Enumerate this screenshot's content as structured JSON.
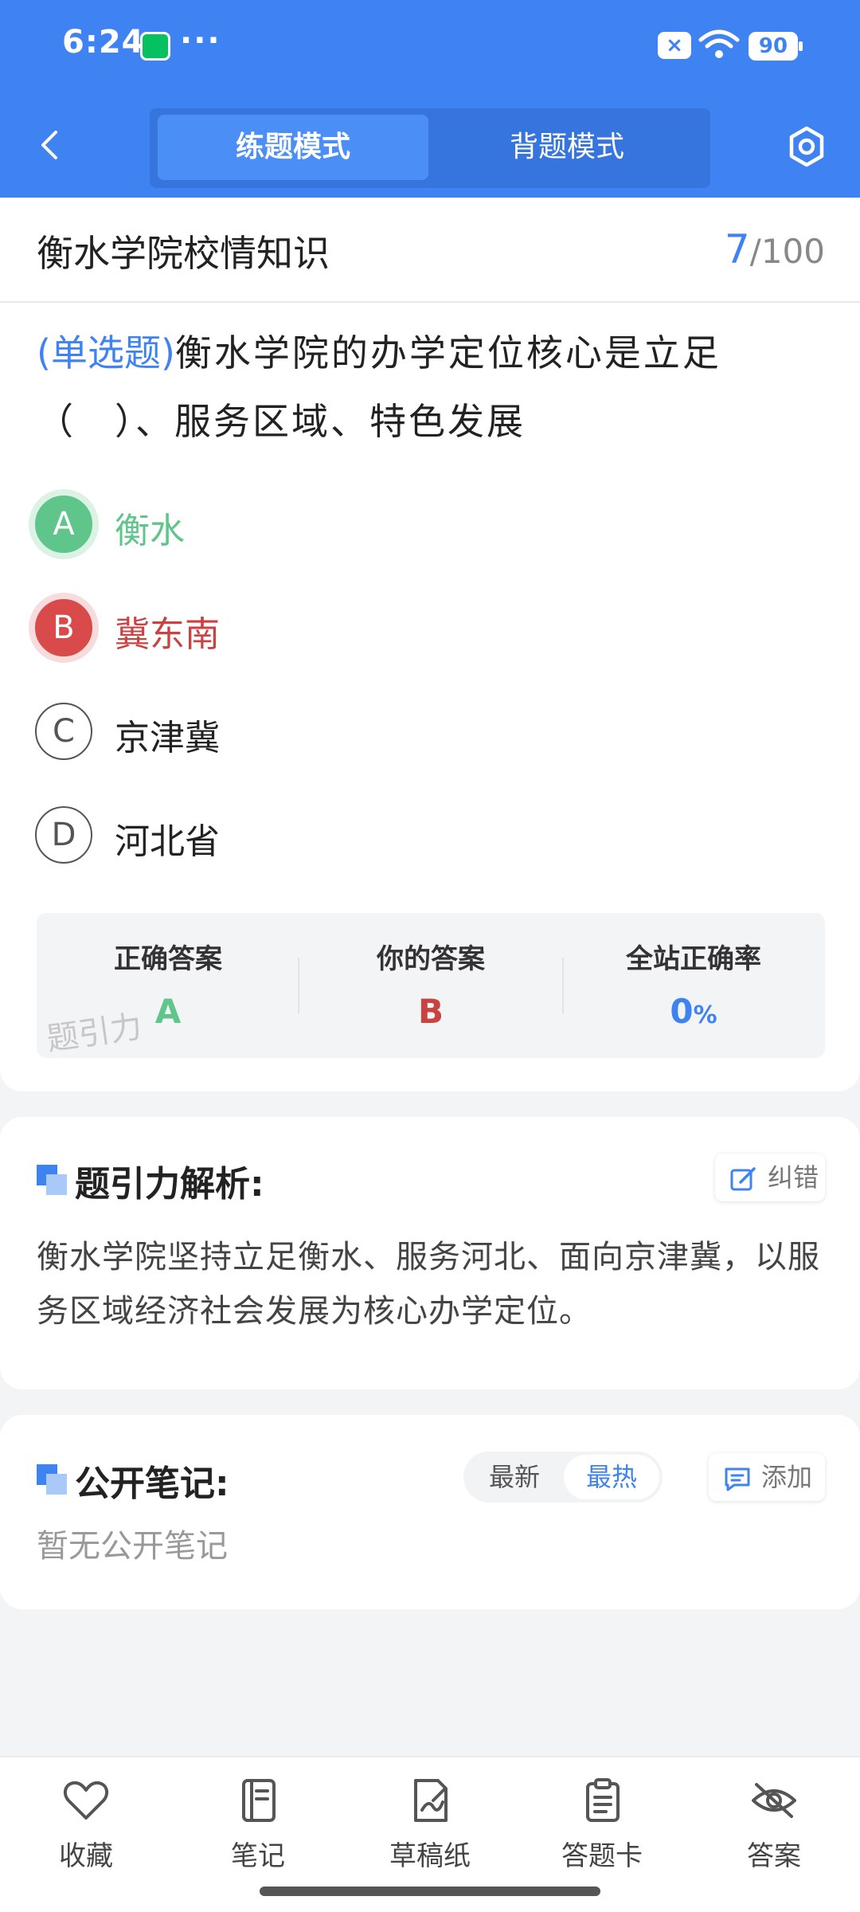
{
  "status_bar": {
    "time": "6:24",
    "dots": "···",
    "sim": "×",
    "battery": "90"
  },
  "header": {
    "modes": [
      "练题模式",
      "背题模式"
    ],
    "active_mode": "练题模式",
    "accent_color": "#3f83f2"
  },
  "quiz": {
    "section_title": "衡水学院校情知识",
    "progress_current": "7",
    "progress_total": "/100",
    "question_type": "(单选题)",
    "question_text": "衡水学院的办学定位核心是立足（　）、服务区域、特色发展",
    "options": [
      {
        "letter": "A",
        "text": "衡水",
        "state": "correct"
      },
      {
        "letter": "B",
        "text": "冀东南",
        "state": "wrong"
      },
      {
        "letter": "C",
        "text": "京津冀",
        "state": "normal"
      },
      {
        "letter": "D",
        "text": "河北省",
        "state": "normal"
      }
    ]
  },
  "result": {
    "correct_label": "正确答案",
    "correct_value": "A",
    "yours_label": "你的答案",
    "yours_value": "B",
    "rate_label": "全站正确率",
    "rate_value": "0",
    "rate_unit": "%",
    "watermark": "题引力",
    "correct_color": "#5fc58a",
    "wrong_color": "#c94343"
  },
  "analysis": {
    "title": "题引力解析:",
    "report_label": "纠错",
    "text": "衡水学院坚持立足衡水、服务河北、面向京津冀，以服务区域经济社会发展为核心办学定位。"
  },
  "notes": {
    "title": "公开笔记:",
    "sort_options": [
      "最新",
      "最热"
    ],
    "active_sort": "最热",
    "add_label": "添加",
    "empty_text": "暂无公开笔记"
  },
  "bottom_nav": [
    {
      "label": "收藏",
      "icon": "heart-icon"
    },
    {
      "label": "笔记",
      "icon": "notebook-icon"
    },
    {
      "label": "草稿纸",
      "icon": "draft-paper-icon"
    },
    {
      "label": "答题卡",
      "icon": "answer-sheet-icon"
    },
    {
      "label": "答案",
      "icon": "eye-off-icon"
    }
  ]
}
